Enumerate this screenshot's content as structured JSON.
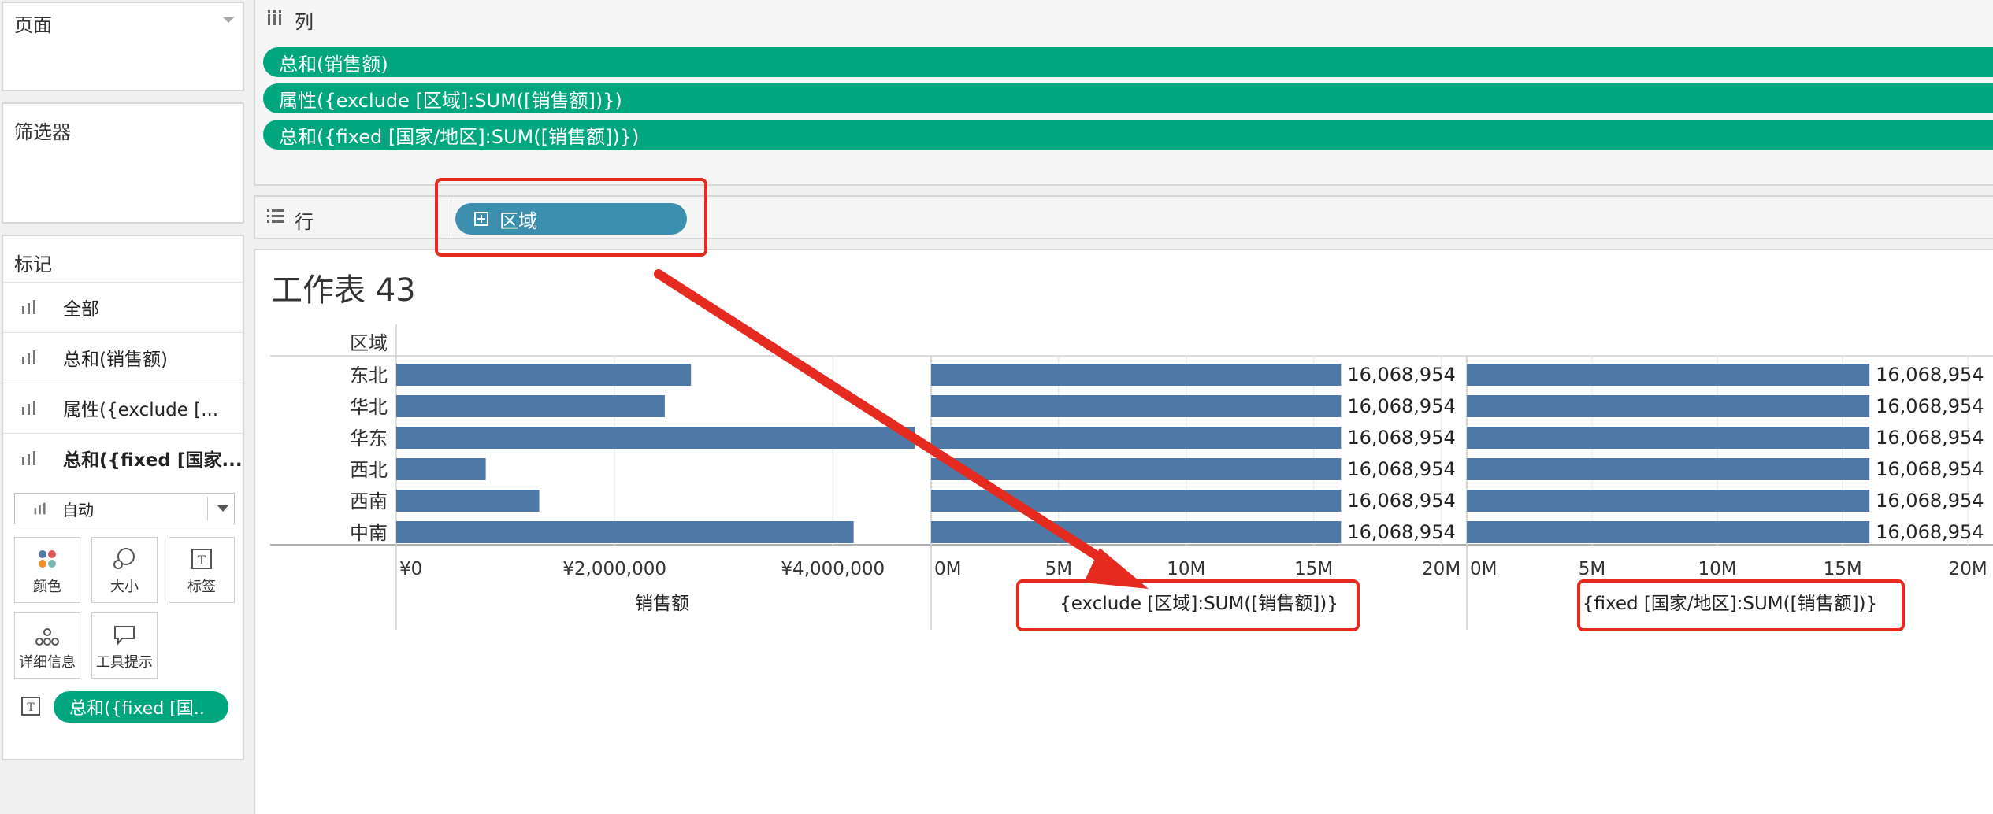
{
  "left_panel": {
    "pages_title": "页面",
    "filters_title": "筛选器",
    "marks": {
      "title": "标记",
      "items": [
        {
          "label": "全部",
          "bold": false
        },
        {
          "label": "总和(销售额)",
          "bold": false
        },
        {
          "label": "属性({exclude [...",
          "bold": false
        },
        {
          "label": "总和({fixed [国家...",
          "bold": true
        }
      ],
      "mark_type": "自动",
      "buttons": [
        "颜色",
        "大小",
        "标签",
        "详细信息",
        "工具提示"
      ],
      "label_pill": "总和({fixed [国.."
    }
  },
  "shelves": {
    "columns_title": "列",
    "columns_pills": [
      "总和(销售额)",
      "属性({exclude [区域]:SUM([销售额])})",
      "总和({fixed [国家/地区]:SUM([销售额])})"
    ],
    "rows_title": "行",
    "rows_pill": "区域"
  },
  "worksheet": {
    "title": "工作表 43",
    "row_header": "区域"
  },
  "chart_data": {
    "type": "bar",
    "orientation": "horizontal",
    "categories": [
      "东北",
      "华北",
      "华东",
      "西北",
      "西南",
      "中南"
    ],
    "bar_color": "#4e79a7",
    "panels": [
      {
        "xlabel": "销售额",
        "values": [
          2700000,
          2460000,
          4750000,
          820000,
          1310000,
          4190000
        ],
        "xlim": [
          0,
          4900000
        ],
        "ticks": [
          0,
          2000000,
          4000000
        ],
        "tick_labels": [
          "¥0",
          "¥2,000,000",
          "¥4,000,000"
        ],
        "show_value_labels": false
      },
      {
        "xlabel": "{exclude [区域]:SUM([销售额])}",
        "values": [
          16068954,
          16068954,
          16068954,
          16068954,
          16068954,
          16068954
        ],
        "value_labels": [
          "16,068,954",
          "16,068,954",
          "16,068,954",
          "16,068,954",
          "16,068,954",
          "16,068,954"
        ],
        "xlim": [
          0,
          21000000
        ],
        "ticks": [
          0,
          5000000,
          10000000,
          15000000,
          20000000
        ],
        "tick_labels": [
          "0M",
          "5M",
          "10M",
          "15M",
          "20M"
        ],
        "show_value_labels": true
      },
      {
        "xlabel": "{fixed [国家/地区]:SUM([销售额])}",
        "values": [
          16068954,
          16068954,
          16068954,
          16068954,
          16068954,
          16068954
        ],
        "value_labels": [
          "16,068,954",
          "16,068,954",
          "16,068,954",
          "16,068,954",
          "16,068,954",
          "16,068,954"
        ],
        "xlim": [
          0,
          21000000
        ],
        "ticks": [
          0,
          5000000,
          10000000,
          15000000,
          20000000
        ],
        "tick_labels": [
          "0M",
          "5M",
          "10M",
          "15M",
          "20M"
        ],
        "show_value_labels": true
      }
    ]
  },
  "colors": {
    "pill_green": "#00a67e",
    "pill_blue": "#3d8fb0",
    "bar": "#4e79a7",
    "highlight_red": "#e52b20"
  }
}
